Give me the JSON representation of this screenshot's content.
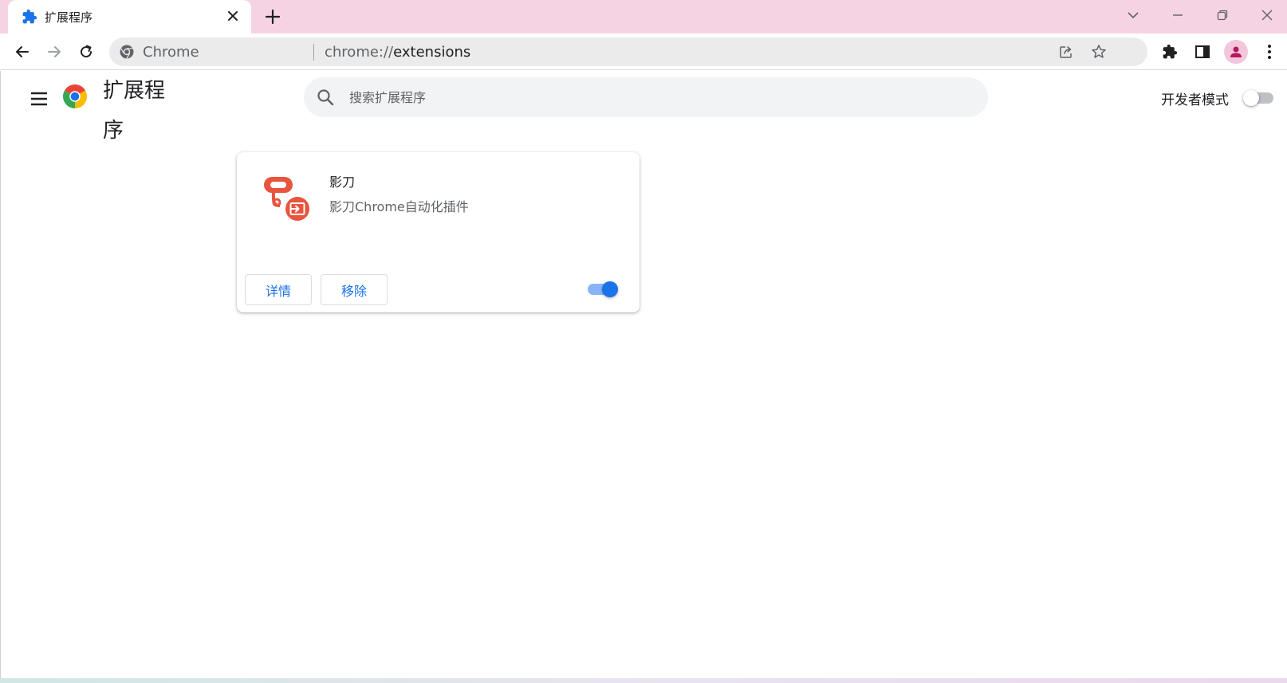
{
  "tab": {
    "title": "扩展程序",
    "favicon": "puzzle-icon"
  },
  "window_controls": [
    "chevron-down-icon",
    "minimize-icon",
    "restore-icon",
    "close-icon"
  ],
  "omnibox": {
    "chip": "Chrome",
    "url_scheme": "chrome://",
    "url_host": "extensions"
  },
  "page": {
    "title": "扩展程序",
    "search_placeholder": "搜索扩展程序",
    "dev_mode_label": "开发者模式",
    "dev_mode_enabled": false
  },
  "extension": {
    "name": "影刀",
    "description": "影刀Chrome自动化插件",
    "details_label": "详情",
    "remove_label": "移除",
    "enabled": true,
    "icon_color": "#e8543e"
  },
  "colors": {
    "tabstrip": "#f6d3e3",
    "accent": "#1a73e8"
  }
}
